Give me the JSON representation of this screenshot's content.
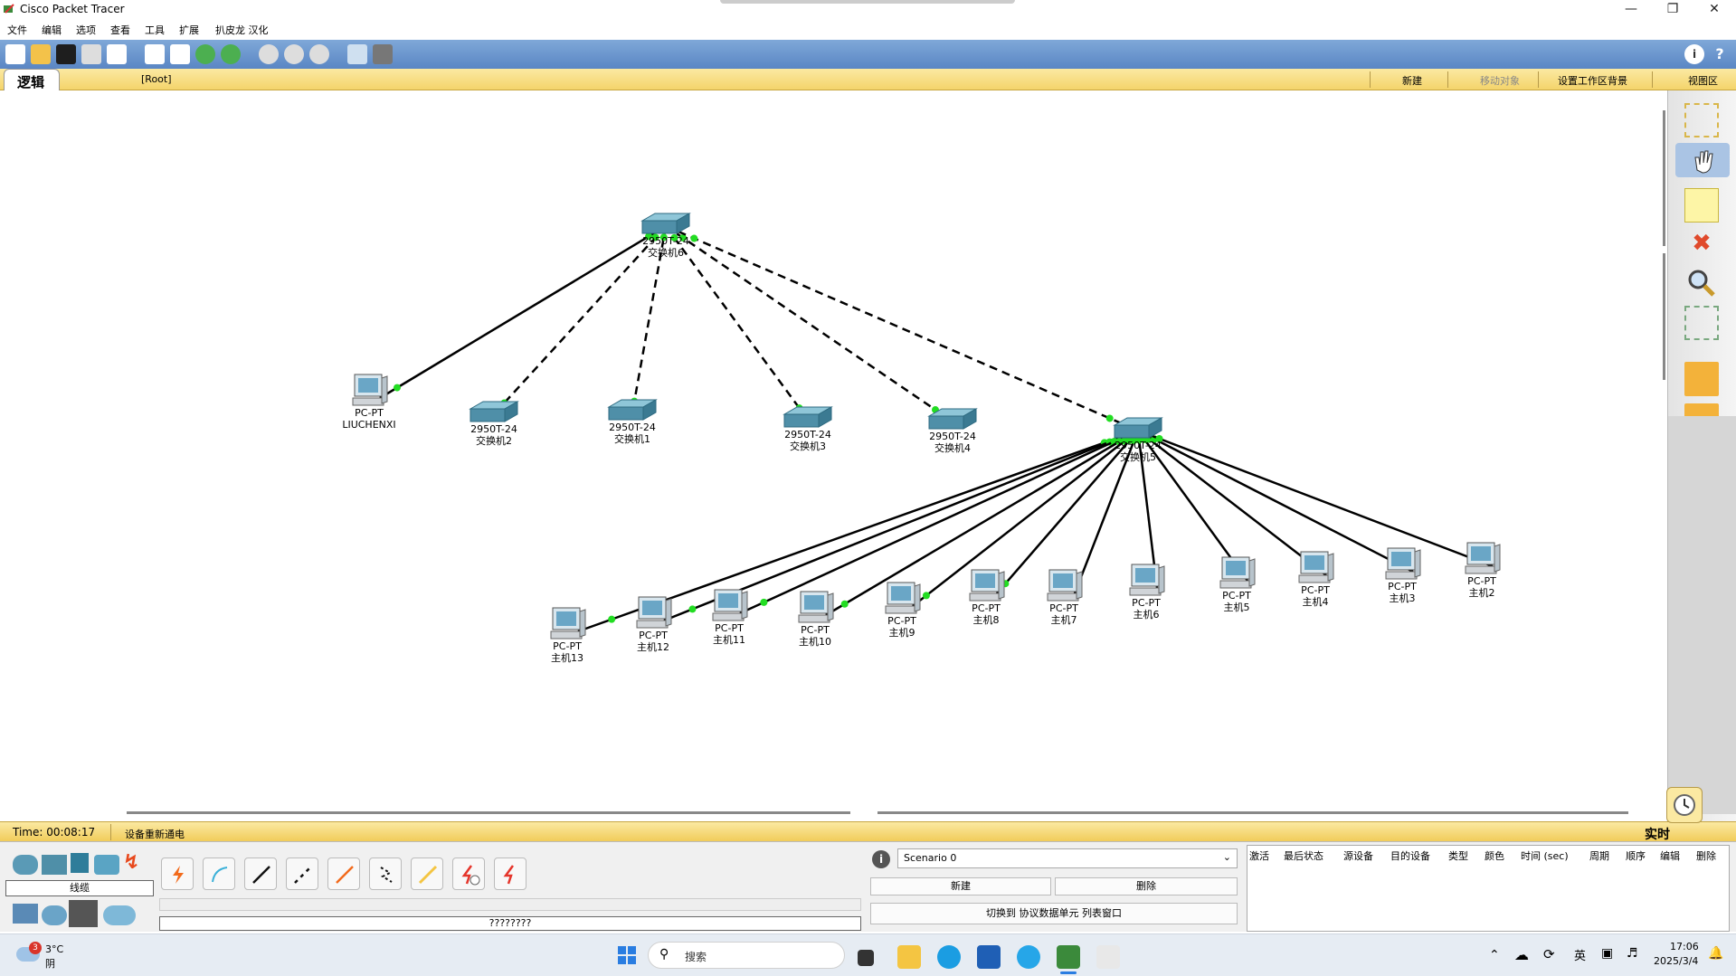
{
  "window": {
    "title": "Cisco Packet Tracer"
  },
  "menu": [
    "文件",
    "编辑",
    "选项",
    "查看",
    "工具",
    "扩展",
    "扒皮龙 汉化"
  ],
  "yellowbar": {
    "mode_tab": "逻辑",
    "root": "[Root]",
    "new_cluster": "新建",
    "move_object": "移动对象",
    "set_bg": "设置工作区背景",
    "viewport": "视图区"
  },
  "status": {
    "time": "Time: 00:08:17",
    "power_cycle": "设备重新通电",
    "realtime": "实时"
  },
  "device_panel": {
    "category_label": "线缆",
    "cable_name": "????????"
  },
  "scenario": {
    "name": "Scenario 0",
    "new_btn": "新建",
    "delete_btn": "删除",
    "toggle_btn": "切换到 协议数据单元 列表窗口"
  },
  "pdu_headers": [
    "激活",
    "最后状态",
    "源设备",
    "目的设备",
    "类型",
    "颜色",
    "时间 (sec)",
    "周期",
    "顺序",
    "编辑",
    "删除"
  ],
  "taskbar": {
    "weather_temp": "3°C",
    "weather_desc": "阴",
    "weather_badge": "3",
    "search": "搜索",
    "ime": "英",
    "time": "17:06",
    "date": "2025/3/4"
  },
  "devices": [
    {
      "id": "sw6",
      "type": "switch",
      "l1": "2950T-24",
      "l2": "交换机6"
    },
    {
      "id": "pcl",
      "type": "pc",
      "l1": "PC-PT",
      "l2": "LIUCHENXI"
    },
    {
      "id": "sw2",
      "type": "switch",
      "l1": "2950T-24",
      "l2": "交换机2"
    },
    {
      "id": "sw1",
      "type": "switch",
      "l1": "2950T-24",
      "l2": "交换机1"
    },
    {
      "id": "sw3",
      "type": "switch",
      "l1": "2950T-24",
      "l2": "交换机3"
    },
    {
      "id": "sw4",
      "type": "switch",
      "l1": "2950T-24",
      "l2": "交换机4"
    },
    {
      "id": "sw5",
      "type": "switch",
      "l1": "2950T-24",
      "l2": "交换机5"
    },
    {
      "id": "h13",
      "type": "pc",
      "l1": "PC-PT",
      "l2": "主机13"
    },
    {
      "id": "h12",
      "type": "pc",
      "l1": "PC-PT",
      "l2": "主机12"
    },
    {
      "id": "h11",
      "type": "pc",
      "l1": "PC-PT",
      "l2": "主机11"
    },
    {
      "id": "h10",
      "type": "pc",
      "l1": "PC-PT",
      "l2": "主机10"
    },
    {
      "id": "h9",
      "type": "pc",
      "l1": "PC-PT",
      "l2": "主机9"
    },
    {
      "id": "h8",
      "type": "pc",
      "l1": "PC-PT",
      "l2": "主机8"
    },
    {
      "id": "h7",
      "type": "pc",
      "l1": "PC-PT",
      "l2": "主机7"
    },
    {
      "id": "h6",
      "type": "pc",
      "l1": "PC-PT",
      "l2": "主机6"
    },
    {
      "id": "h5",
      "type": "pc",
      "l1": "PC-PT",
      "l2": "主机5"
    },
    {
      "id": "h4",
      "type": "pc",
      "l1": "PC-PT",
      "l2": "主机4"
    },
    {
      "id": "h3",
      "type": "pc",
      "l1": "PC-PT",
      "l2": "主机3"
    },
    {
      "id": "h2",
      "type": "pc",
      "l1": "PC-PT",
      "l2": "主机2"
    }
  ],
  "links": [
    {
      "a": "sw6",
      "b": "pcl",
      "style": "solid"
    },
    {
      "a": "sw6",
      "b": "sw2",
      "style": "dashed"
    },
    {
      "a": "sw6",
      "b": "sw1",
      "style": "dashed"
    },
    {
      "a": "sw6",
      "b": "sw3",
      "style": "dashed"
    },
    {
      "a": "sw6",
      "b": "sw4",
      "style": "dashed"
    },
    {
      "a": "sw6",
      "b": "sw5",
      "style": "dashed"
    },
    {
      "a": "sw5",
      "b": "h13",
      "style": "solid"
    },
    {
      "a": "sw5",
      "b": "h12",
      "style": "solid"
    },
    {
      "a": "sw5",
      "b": "h11",
      "style": "solid"
    },
    {
      "a": "sw5",
      "b": "h10",
      "style": "solid"
    },
    {
      "a": "sw5",
      "b": "h9",
      "style": "solid"
    },
    {
      "a": "sw5",
      "b": "h8",
      "style": "solid"
    },
    {
      "a": "sw5",
      "b": "h7",
      "style": "solid"
    },
    {
      "a": "sw5",
      "b": "h6",
      "style": "solid"
    },
    {
      "a": "sw5",
      "b": "h5",
      "style": "solid"
    },
    {
      "a": "sw5",
      "b": "h4",
      "style": "solid"
    },
    {
      "a": "sw5",
      "b": "h3",
      "style": "solid"
    },
    {
      "a": "sw5",
      "b": "h2",
      "style": "solid"
    }
  ],
  "colors": {
    "toolbar": "#5a86c4",
    "yellow": "#f4d46b",
    "switch": "#4f8fa8",
    "link_dot": "#22dd22"
  }
}
